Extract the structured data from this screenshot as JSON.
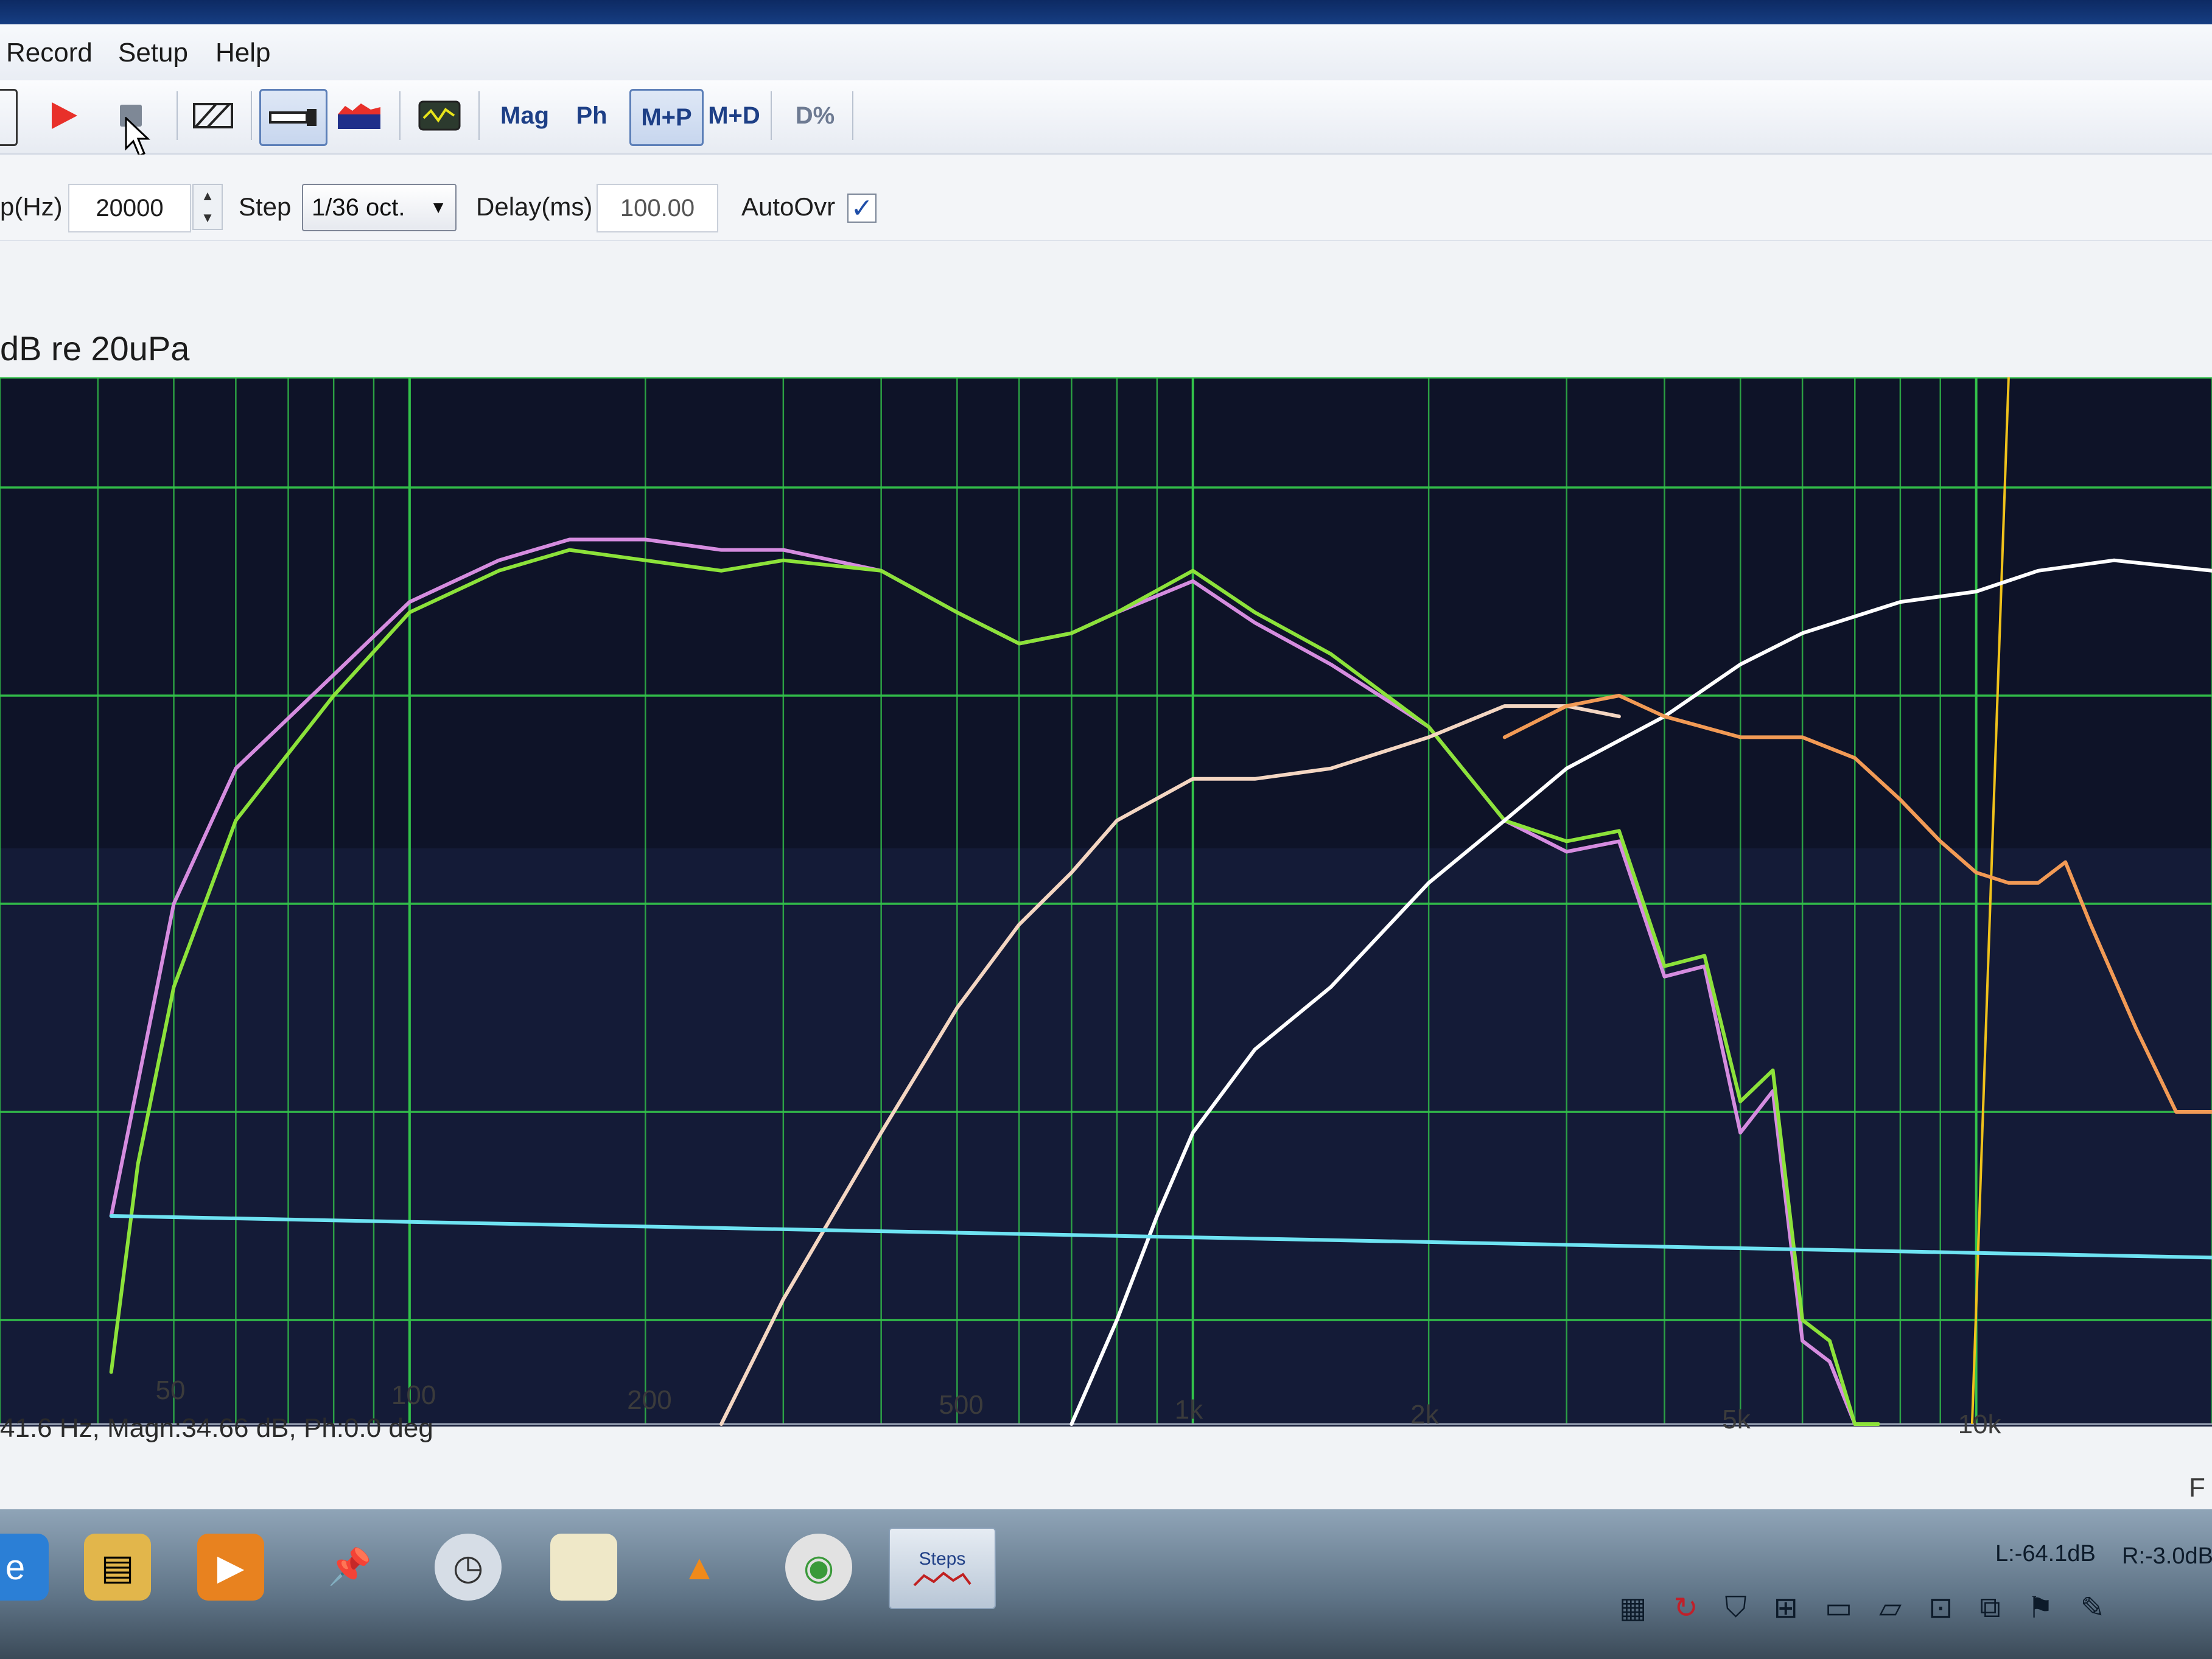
{
  "menu": {
    "items": [
      "Record",
      "Setup",
      "Help"
    ]
  },
  "toolbar": {
    "mag": "Mag",
    "ph": "Ph",
    "mp": "M+P",
    "md": "M+D",
    "dpct": "D%"
  },
  "options": {
    "freq_label": "p(Hz)",
    "freq_value": "20000",
    "step_label": "Step",
    "step_value": "1/36 oct.",
    "delay_label": "Delay(ms)",
    "delay_value": "100.00",
    "autoovr_label": "AutoOvr",
    "autoovr_checked": true
  },
  "plot": {
    "units_label": "dB re 20uPa",
    "status": "41.6 Hz, Magn:34.66 dB, Ph:0.0 deg",
    "axis_end": "F",
    "background": "#0d1224",
    "grid_color": "#33c24a"
  },
  "chart_data": {
    "type": "line",
    "title": "",
    "xlabel": "",
    "ylabel": "dB re 20uPa",
    "xscale": "log",
    "xlim": [
      30,
      20000
    ],
    "x_ticks": [
      {
        "value": 50,
        "label": "50"
      },
      {
        "value": 100,
        "label": "100"
      },
      {
        "value": 200,
        "label": "200"
      },
      {
        "value": 500,
        "label": "500"
      },
      {
        "value": 1000,
        "label": "1k"
      },
      {
        "value": 2000,
        "label": "2k"
      },
      {
        "value": 5000,
        "label": "5k"
      },
      {
        "value": 10000,
        "label": "10k"
      }
    ],
    "ylim": [
      0,
      100
    ],
    "grid": true,
    "series": [
      {
        "color": "#d58cdf",
        "x": [
          41.6,
          50,
          60,
          80,
          100,
          130,
          160,
          200,
          250,
          300,
          400,
          500,
          600,
          700,
          800,
          1000,
          1200,
          1500,
          2000,
          2500,
          3000,
          3500,
          4000,
          4500,
          5000,
          5500,
          6000,
          6500,
          7000,
          7500
        ],
        "y": [
          20,
          50,
          63,
          72,
          79,
          83,
          85,
          85,
          84,
          84,
          82,
          78,
          75,
          76,
          78,
          81,
          77,
          73,
          67,
          58,
          55,
          56,
          43,
          44,
          28,
          32,
          8,
          6,
          0,
          0
        ]
      },
      {
        "color": "#8ce23a",
        "x": [
          41.6,
          45,
          50,
          60,
          80,
          100,
          130,
          160,
          200,
          250,
          300,
          400,
          500,
          600,
          700,
          800,
          1000,
          1200,
          1500,
          2000,
          2500,
          3000,
          3500,
          4000,
          4500,
          5000,
          5500,
          6000,
          6500,
          7000,
          7500
        ],
        "y": [
          5,
          25,
          42,
          58,
          70,
          78,
          82,
          84,
          83,
          82,
          83,
          82,
          78,
          75,
          76,
          78,
          82,
          78,
          74,
          67,
          58,
          56,
          57,
          44,
          45,
          31,
          34,
          10,
          8,
          0,
          0
        ]
      },
      {
        "color": "#f4d6c2",
        "x": [
          250,
          300,
          400,
          500,
          600,
          700,
          800,
          1000,
          1200,
          1500,
          2000,
          2500,
          3000,
          3500
        ],
        "y": [
          0,
          12,
          28,
          40,
          48,
          53,
          58,
          62,
          62,
          63,
          66,
          69,
          69,
          68
        ]
      },
      {
        "color": "#ffffff",
        "x": [
          700,
          800,
          900,
          1000,
          1200,
          1500,
          2000,
          2500,
          3000,
          4000,
          5000,
          6000,
          8000,
          10000,
          12000,
          15000,
          20000
        ],
        "y": [
          0,
          10,
          20,
          28,
          36,
          42,
          52,
          58,
          63,
          68,
          73,
          76,
          79,
          80,
          82,
          83,
          82
        ]
      },
      {
        "color": "#f29a55",
        "x": [
          2500,
          3000,
          3500,
          4000,
          5000,
          6000,
          7000,
          8000,
          9000,
          10000,
          11000,
          12000,
          13000,
          14000,
          16000,
          18000,
          20000
        ],
        "y": [
          66,
          69,
          70,
          68,
          66,
          66,
          64,
          60,
          56,
          53,
          52,
          52,
          54,
          48,
          38,
          30,
          30
        ]
      },
      {
        "color": "#6ee3f2",
        "x": [
          41.6,
          20000
        ],
        "y": [
          20,
          16
        ]
      }
    ],
    "markers": [
      {
        "color": "#f0c21b",
        "x": 11000
      }
    ]
  },
  "taskbar": {
    "steps_label": "Steps",
    "level_left": "L:-64.1dB",
    "level_right": "R:-3.0dB"
  }
}
